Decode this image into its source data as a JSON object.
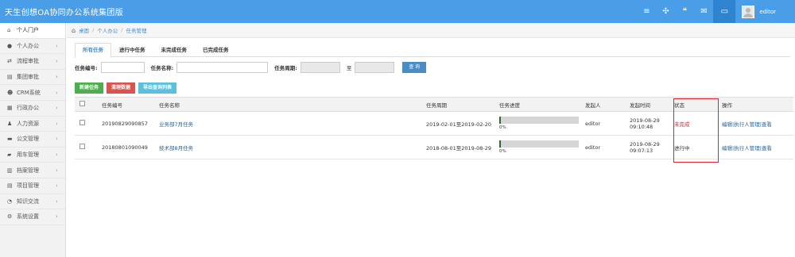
{
  "app": {
    "title": "天生创想OA协同办公系统集团版"
  },
  "topbar": {
    "icons": [
      "menu-icon",
      "expand-icon",
      "chat-icon",
      "mail-icon",
      "message-icon"
    ],
    "username": "editor"
  },
  "sidebar": {
    "items": [
      {
        "label": "个人门户",
        "icon": "home-icon",
        "active": true,
        "has_arrow": false
      },
      {
        "label": "个人办公",
        "icon": "user-icon",
        "has_arrow": true
      },
      {
        "label": "流程审批",
        "icon": "retweet-icon",
        "has_arrow": true
      },
      {
        "label": "集团审批",
        "icon": "list-icon",
        "has_arrow": true
      },
      {
        "label": "CRM系统",
        "icon": "users-icon",
        "has_arrow": true
      },
      {
        "label": "行政办公",
        "icon": "building-icon",
        "has_arrow": true
      },
      {
        "label": "人力资源",
        "icon": "person-icon",
        "has_arrow": true
      },
      {
        "label": "公文管理",
        "icon": "folder-icon",
        "has_arrow": true
      },
      {
        "label": "用车管理",
        "icon": "car-icon",
        "has_arrow": true
      },
      {
        "label": "档案管理",
        "icon": "archive-icon",
        "has_arrow": true
      },
      {
        "label": "项目管理",
        "icon": "project-icon",
        "has_arrow": true
      },
      {
        "label": "知识交流",
        "icon": "knowledge-icon",
        "has_arrow": true
      },
      {
        "label": "系统设置",
        "icon": "settings-icon",
        "has_arrow": true
      }
    ]
  },
  "breadcrumb": {
    "items": [
      "桌面",
      "个人办公",
      "任务管理"
    ]
  },
  "tabs": [
    {
      "label": "所有任务",
      "active": true
    },
    {
      "label": "进行中任务"
    },
    {
      "label": "未完成任务"
    },
    {
      "label": "已完成任务"
    }
  ],
  "search": {
    "task_no_label": "任务编号:",
    "task_name_label": "任务名称:",
    "period_label": "任务周期:",
    "to_label": "至",
    "query_button": "查 询"
  },
  "actions": {
    "new": "新建任务",
    "clear": "清理数据",
    "export": "导出查询列表"
  },
  "table": {
    "headers": [
      "任务编号",
      "任务名称",
      "任务周期",
      "任务进度",
      "发起人",
      "发起时间",
      "状态",
      "操作"
    ],
    "rows": [
      {
        "no": "20190829090857",
        "name": "业务部7月任务",
        "period": "2019-02-01至2019-02-20",
        "progress": 0,
        "progress_text": "0%",
        "initiator": "editor",
        "date": "2019-08-29",
        "time": "09:10:48",
        "status": "未完成",
        "status_color": "#c9302c",
        "ops": "编辑|执行人管理|查看"
      },
      {
        "no": "20180801090049",
        "name": "技术部8月任务",
        "period": "2018-08-01至2019-08-29",
        "progress": 0,
        "progress_text": "0%",
        "initiator": "editor",
        "date": "2019-08-29",
        "time": "09:07:13",
        "status": "进行中",
        "status_color": "#333333",
        "ops": "编辑|执行人管理|查看"
      }
    ]
  },
  "colors": {
    "topbar": "#4a9ee8",
    "accent": "#4a8dc5",
    "highlight": "#d9232e"
  }
}
